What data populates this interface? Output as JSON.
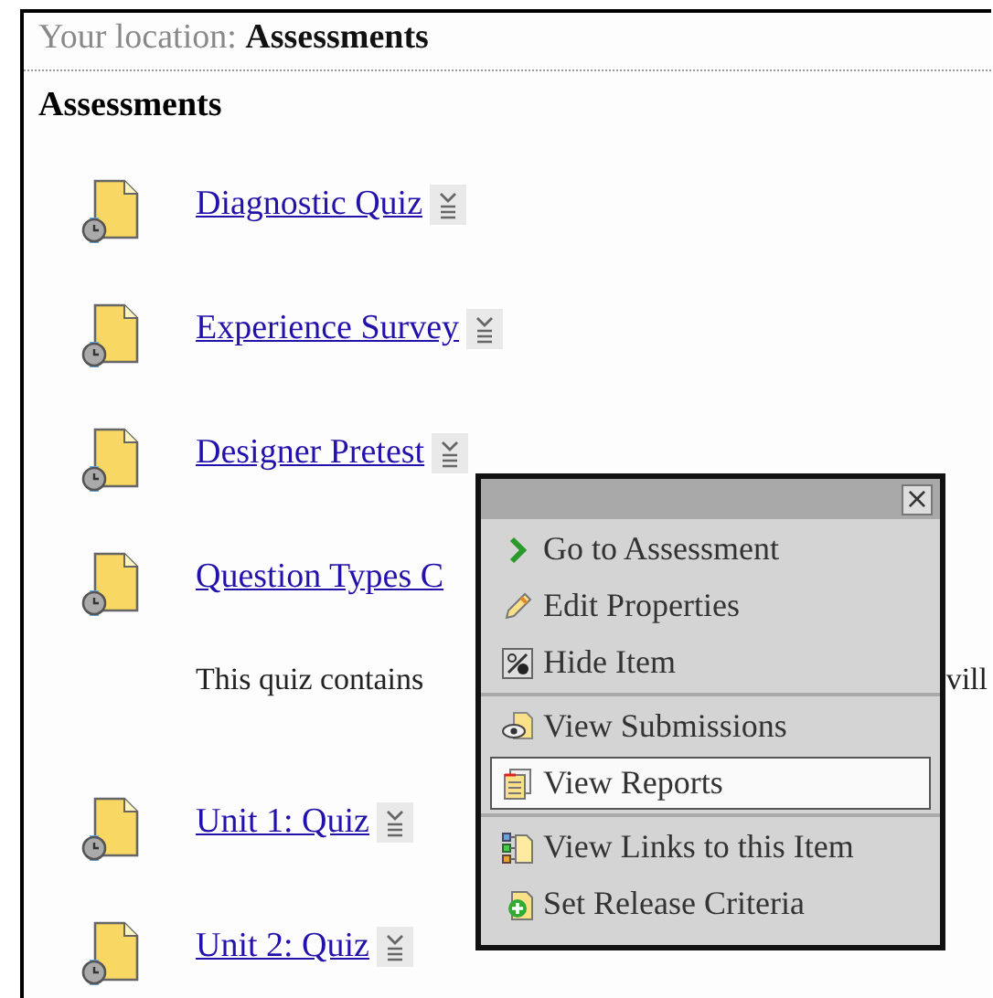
{
  "location": {
    "label": "Your location:",
    "current": "Assessments"
  },
  "heading": "Assessments",
  "items": [
    {
      "title": "Diagnostic Quiz",
      "menu_button": true
    },
    {
      "title": "Experience Survey",
      "menu_button": true
    },
    {
      "title": "Designer Pretest",
      "menu_button": true
    },
    {
      "title": "Question Types C",
      "menu_button": false,
      "description_start": "This quiz contains",
      "description_end": "vill"
    },
    {
      "title": "Unit 1: Quiz",
      "menu_button": true
    },
    {
      "title": "Unit 2: Quiz",
      "menu_button": true
    }
  ],
  "menu": {
    "close": "×",
    "groups": [
      [
        {
          "label": "Go to Assessment",
          "selected": false
        },
        {
          "label": "Edit Properties",
          "selected": false
        },
        {
          "label": "Hide Item",
          "selected": false
        }
      ],
      [
        {
          "label": "View Submissions",
          "selected": false
        },
        {
          "label": "View Reports",
          "selected": true
        }
      ],
      [
        {
          "label": "View Links to this Item",
          "selected": false
        },
        {
          "label": "Set Release Criteria",
          "selected": false
        }
      ]
    ]
  }
}
